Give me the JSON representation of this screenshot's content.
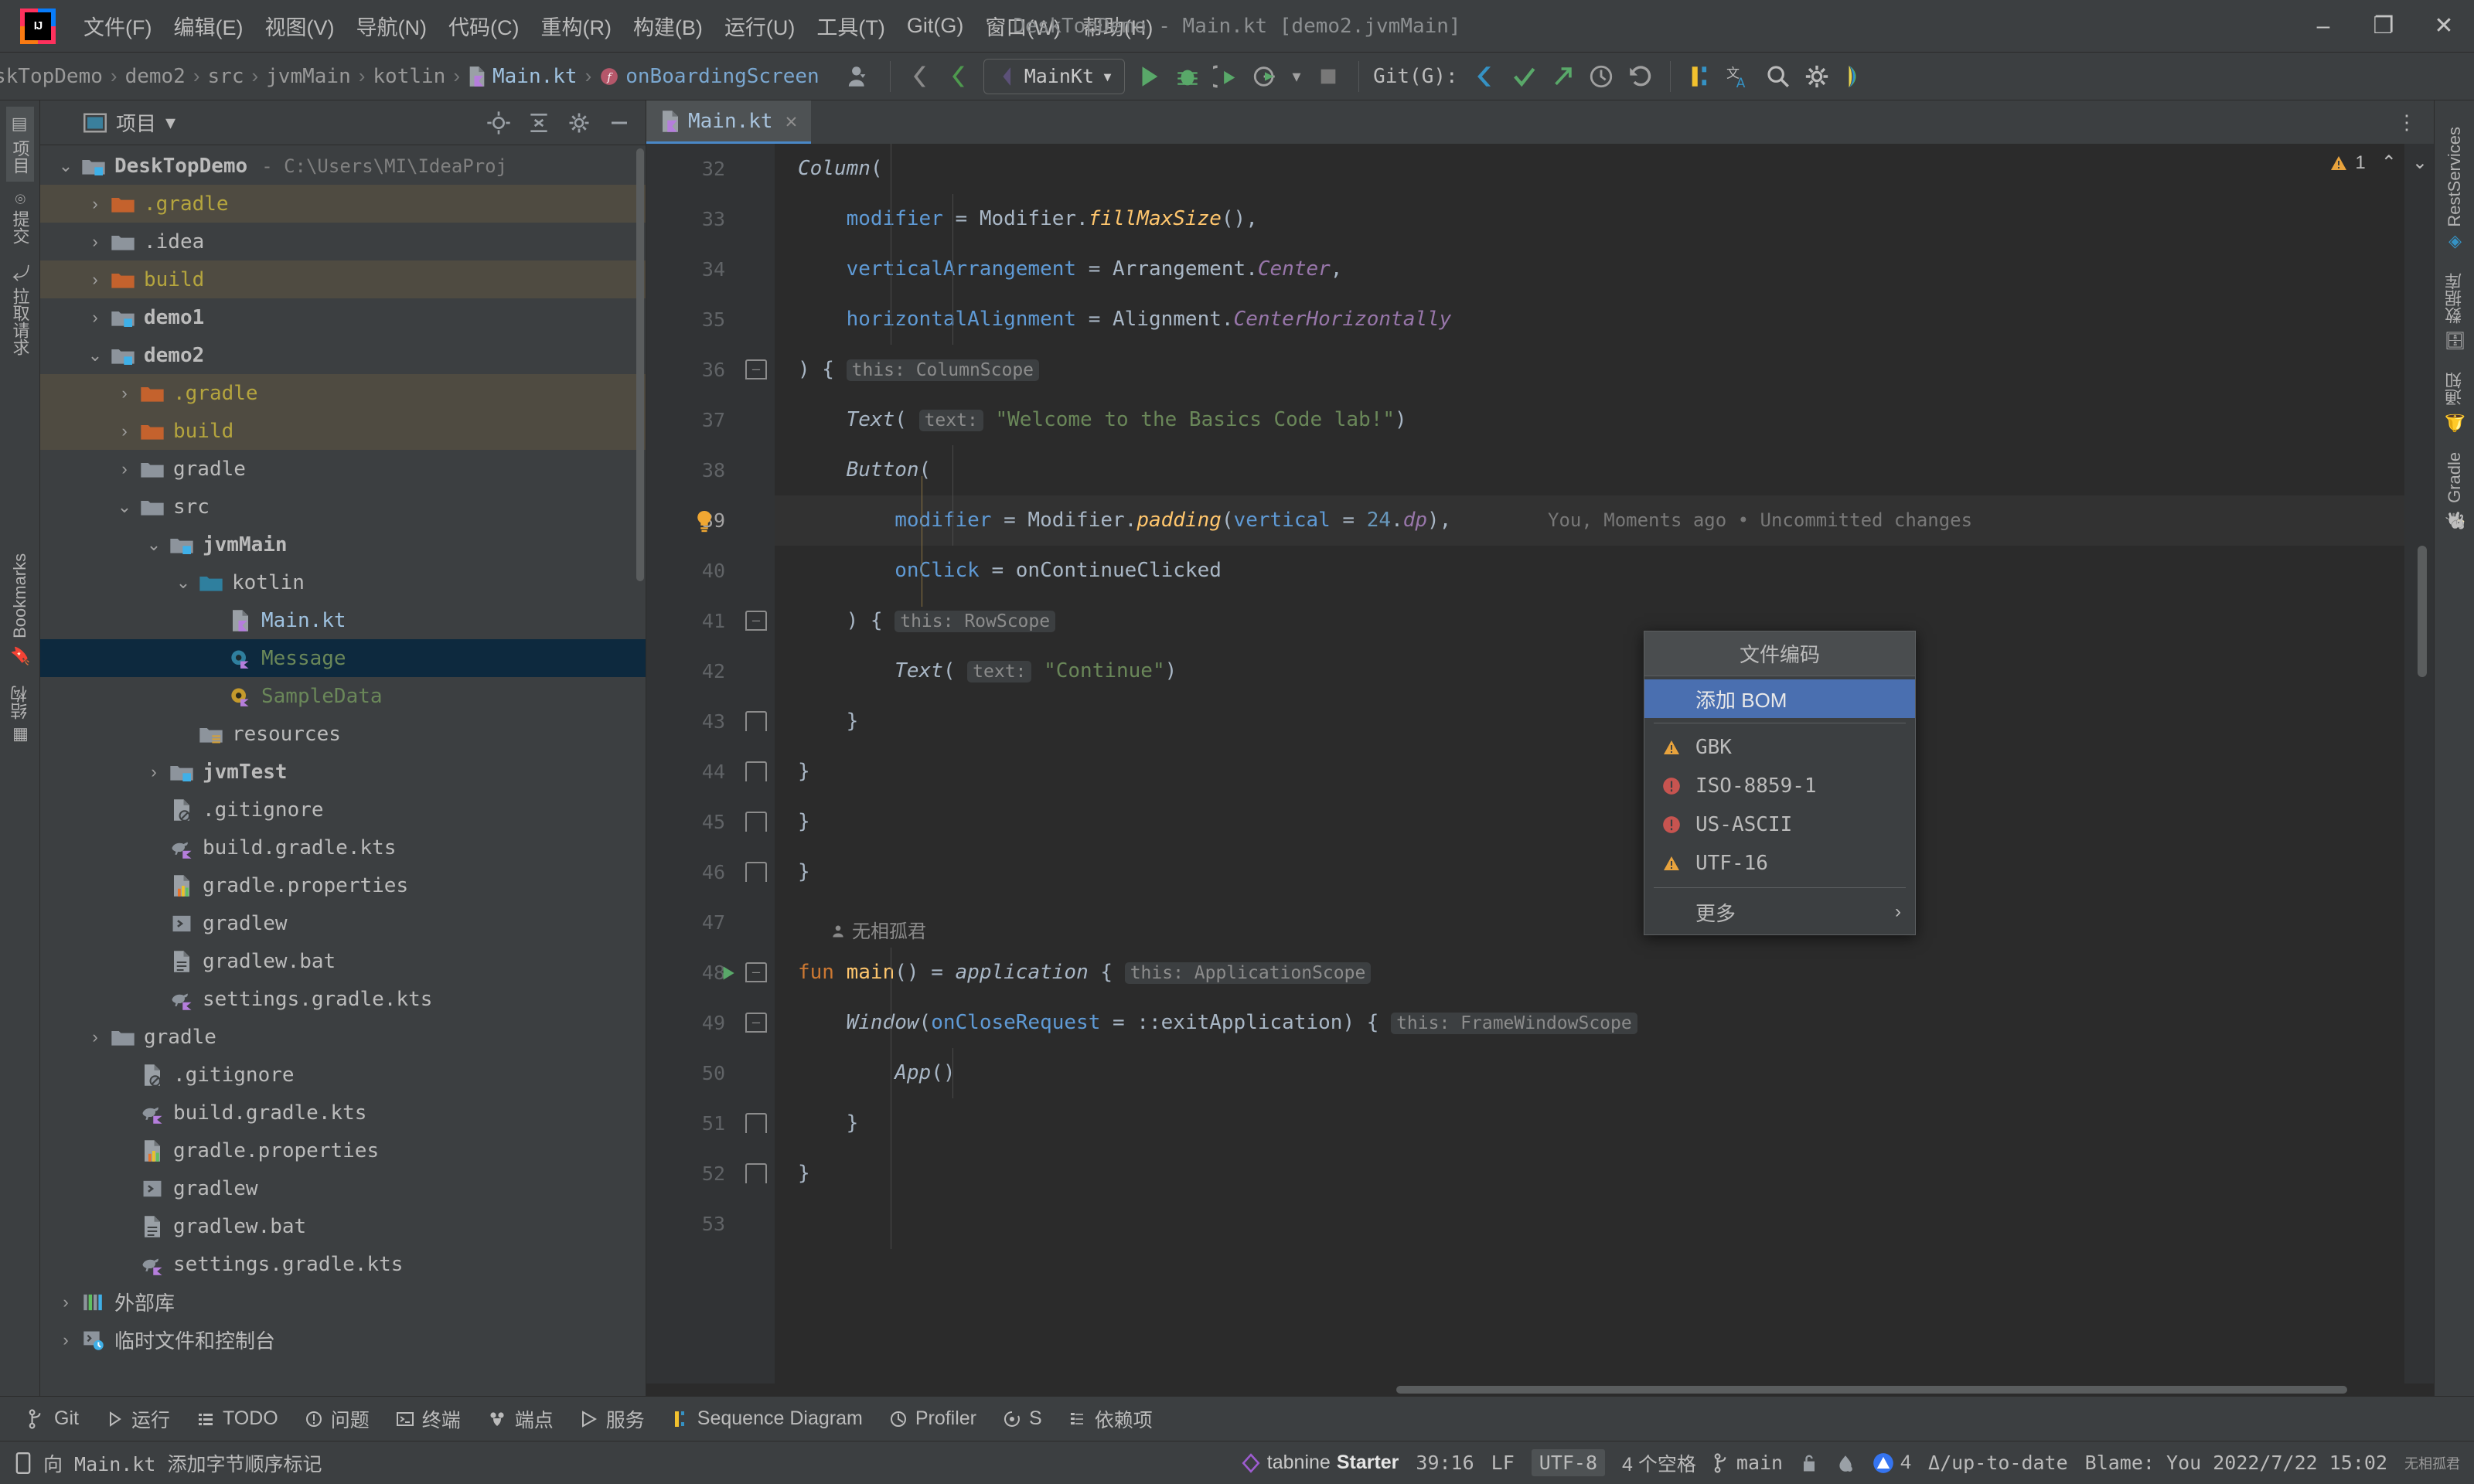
{
  "window": {
    "title": "DeskTopDemo - Main.kt [demo2.jvmMain]",
    "minimize": "–",
    "maximize": "❐",
    "close": "✕",
    "logo_text": "IJ"
  },
  "menubar": {
    "items": [
      {
        "label": "文件(F)",
        "name": "menu-file"
      },
      {
        "label": "编辑(E)",
        "name": "menu-edit"
      },
      {
        "label": "视图(V)",
        "name": "menu-view"
      },
      {
        "label": "导航(N)",
        "name": "menu-navigate"
      },
      {
        "label": "代码(C)",
        "name": "menu-code"
      },
      {
        "label": "重构(R)",
        "name": "menu-refactor"
      },
      {
        "label": "构建(B)",
        "name": "menu-build"
      },
      {
        "label": "运行(U)",
        "name": "menu-run"
      },
      {
        "label": "工具(T)",
        "name": "menu-tools"
      },
      {
        "label": "Git(G)",
        "name": "menu-git"
      },
      {
        "label": "窗口(W)",
        "name": "menu-window"
      },
      {
        "label": "帮助(H)",
        "name": "menu-help"
      }
    ]
  },
  "navbar": {
    "breadcrumbs": [
      {
        "label": "skTopDemo",
        "style": "dim"
      },
      {
        "label": "demo2",
        "style": "dim"
      },
      {
        "label": "src",
        "style": "dim"
      },
      {
        "label": "jvmMain",
        "style": "dim"
      },
      {
        "label": "kotlin",
        "style": "dim"
      },
      {
        "label": "Main.kt",
        "style": "file"
      },
      {
        "label": "onBoardingScreen",
        "style": "fn"
      }
    ],
    "separator": "›",
    "run_config": "MainKt",
    "run_config_caret": "▾",
    "git_label": "Git(G):"
  },
  "sidebar_left": {
    "items": [
      {
        "label": "项目",
        "name": "sidebar-item-project",
        "active": true
      },
      {
        "label": "提交",
        "name": "sidebar-item-commit",
        "active": false
      },
      {
        "label": "拉取请求",
        "name": "sidebar-item-pull-requests",
        "active": false
      },
      {
        "label": "Bookmarks",
        "name": "sidebar-item-bookmarks",
        "active": false
      },
      {
        "label": "结构",
        "name": "sidebar-item-structure",
        "active": false
      }
    ]
  },
  "sidebar_right": {
    "items": [
      {
        "label": "RestServices",
        "name": "sidebar-item-restservices"
      },
      {
        "label": "数据库",
        "name": "sidebar-item-database"
      },
      {
        "label": "通知",
        "name": "sidebar-item-notifications"
      },
      {
        "label": "Gradle",
        "name": "sidebar-item-gradle"
      }
    ]
  },
  "project_panel": {
    "title": "项目",
    "caret": "▾",
    "tree": [
      {
        "label": "DeskTopDemo",
        "path": "- C:\\Users\\MI\\IdeaProj",
        "indent": 0,
        "arrow": "v",
        "icon": "module",
        "style": "bold"
      },
      {
        "label": ".gradle",
        "indent": 1,
        "arrow": ">",
        "icon": "folder-orange",
        "style": "yellow",
        "excluded": true
      },
      {
        "label": ".idea",
        "indent": 1,
        "arrow": ">",
        "icon": "folder",
        "style": ""
      },
      {
        "label": "build",
        "indent": 1,
        "arrow": ">",
        "icon": "folder-orange",
        "style": "yellow",
        "excluded": true
      },
      {
        "label": "demo1",
        "indent": 1,
        "arrow": ">",
        "icon": "module",
        "style": "bold"
      },
      {
        "label": "demo2",
        "indent": 1,
        "arrow": "v",
        "icon": "module",
        "style": "bold"
      },
      {
        "label": ".gradle",
        "indent": 2,
        "arrow": ">",
        "icon": "folder-orange",
        "style": "yellow",
        "excluded": true
      },
      {
        "label": "build",
        "indent": 2,
        "arrow": ">",
        "icon": "folder-orange",
        "style": "yellow",
        "excluded": true
      },
      {
        "label": "gradle",
        "indent": 2,
        "arrow": ">",
        "icon": "folder",
        "style": ""
      },
      {
        "label": "src",
        "indent": 2,
        "arrow": "v",
        "icon": "folder",
        "style": ""
      },
      {
        "label": "jvmMain",
        "indent": 3,
        "arrow": "v",
        "icon": "module",
        "style": "bold"
      },
      {
        "label": "kotlin",
        "indent": 4,
        "arrow": "v",
        "icon": "folder-source",
        "style": ""
      },
      {
        "label": "Main.kt",
        "indent": 5,
        "arrow": "",
        "icon": "kotlin-file",
        "style": "blue"
      },
      {
        "label": "Message",
        "indent": 5,
        "arrow": "",
        "icon": "kotlin-class",
        "style": "green",
        "selected": true
      },
      {
        "label": "SampleData",
        "indent": 5,
        "arrow": "",
        "icon": "kotlin-object",
        "style": "green"
      },
      {
        "label": "resources",
        "indent": 4,
        "arrow": "",
        "icon": "folder-resources",
        "style": ""
      },
      {
        "label": "jvmTest",
        "indent": 3,
        "arrow": ">",
        "icon": "module-test",
        "style": "bold"
      },
      {
        "label": ".gitignore",
        "indent": 3,
        "arrow": "",
        "icon": "gitignore",
        "style": ""
      },
      {
        "label": "build.gradle.kts",
        "indent": 3,
        "arrow": "",
        "icon": "gradle-kts",
        "style": ""
      },
      {
        "label": "gradle.properties",
        "indent": 3,
        "arrow": "",
        "icon": "properties",
        "style": ""
      },
      {
        "label": "gradlew",
        "indent": 3,
        "arrow": "",
        "icon": "shell",
        "style": ""
      },
      {
        "label": "gradlew.bat",
        "indent": 3,
        "arrow": "",
        "icon": "text-file",
        "style": ""
      },
      {
        "label": "settings.gradle.kts",
        "indent": 3,
        "arrow": "",
        "icon": "gradle-kts",
        "style": ""
      },
      {
        "label": "gradle",
        "indent": 1,
        "arrow": ">",
        "icon": "folder",
        "style": ""
      },
      {
        "label": ".gitignore",
        "indent": 2,
        "arrow": "",
        "icon": "gitignore",
        "style": ""
      },
      {
        "label": "build.gradle.kts",
        "indent": 2,
        "arrow": "",
        "icon": "gradle-kts",
        "style": ""
      },
      {
        "label": "gradle.properties",
        "indent": 2,
        "arrow": "",
        "icon": "properties",
        "style": ""
      },
      {
        "label": "gradlew",
        "indent": 2,
        "arrow": "",
        "icon": "shell",
        "style": ""
      },
      {
        "label": "gradlew.bat",
        "indent": 2,
        "arrow": "",
        "icon": "text-file",
        "style": ""
      },
      {
        "label": "settings.gradle.kts",
        "indent": 2,
        "arrow": "",
        "icon": "gradle-kts",
        "style": ""
      },
      {
        "label": "外部库",
        "indent": 0,
        "arrow": ">",
        "icon": "libraries",
        "style": ""
      },
      {
        "label": "临时文件和控制台",
        "indent": 0,
        "arrow": ">",
        "icon": "scratches",
        "style": ""
      }
    ]
  },
  "editor": {
    "tab": {
      "label": "Main.kt",
      "close": "✕"
    },
    "kebab": "⋮",
    "warning_count": "1",
    "warning_up": "⌃",
    "warning_down": "⌄",
    "vcs_annotation": "You, Moments ago • Uncommitted changes",
    "author_inlay": "无相孤君",
    "lines": [
      {
        "num": "32",
        "text": "Column("
      },
      {
        "num": "33",
        "text": "    modifier = Modifier.fillMaxSize(),"
      },
      {
        "num": "34",
        "text": "    verticalArrangement = Arrangement.Center,"
      },
      {
        "num": "35",
        "text": "    horizontalAlignment = Alignment.CenterHorizontally"
      },
      {
        "num": "36",
        "text": ") { this: ColumnScope"
      },
      {
        "num": "37",
        "text": "    Text( text: \"Welcome to the Basics Code lab!\")"
      },
      {
        "num": "38",
        "text": "    Button("
      },
      {
        "num": "39",
        "text": "        modifier = Modifier.padding(vertical = 24.dp),"
      },
      {
        "num": "40",
        "text": "        onClick = onContinueClicked"
      },
      {
        "num": "41",
        "text": "    ) { this: RowScope"
      },
      {
        "num": "42",
        "text": "        Text( text: \"Continue\")"
      },
      {
        "num": "43",
        "text": "    }"
      },
      {
        "num": "44",
        "text": "}"
      },
      {
        "num": "45",
        "text": "}"
      },
      {
        "num": "46",
        "text": "}"
      },
      {
        "num": "47",
        "text": ""
      },
      {
        "num": "48",
        "text": "fun main() = application { this: ApplicationScope"
      },
      {
        "num": "49",
        "text": "    Window(onCloseRequest = ::exitApplication) { this: FrameWindowScope"
      },
      {
        "num": "50",
        "text": "        App()"
      },
      {
        "num": "51",
        "text": "    }"
      },
      {
        "num": "52",
        "text": "}"
      },
      {
        "num": "53",
        "text": ""
      }
    ]
  },
  "popup": {
    "title": "文件编码",
    "items": [
      {
        "label": "添加 BOM",
        "icon": "none",
        "selected": true,
        "cjk": true
      },
      {
        "label": "GBK",
        "icon": "warning",
        "selected": false
      },
      {
        "label": "ISO-8859-1",
        "icon": "error",
        "selected": false
      },
      {
        "label": "US-ASCII",
        "icon": "error",
        "selected": false
      },
      {
        "label": "UTF-16",
        "icon": "warning",
        "selected": false
      },
      {
        "label": "更多",
        "icon": "none",
        "selected": false,
        "chevron": "›",
        "cjk": true
      }
    ]
  },
  "toolwindow_bar": {
    "items": [
      {
        "label": "Git",
        "name": "toolwin-git",
        "icon": "branch-icon"
      },
      {
        "label": "运行",
        "name": "toolwin-run",
        "icon": "play-icon"
      },
      {
        "label": "TODO",
        "name": "toolwin-todo",
        "icon": "list-icon"
      },
      {
        "label": "问题",
        "name": "toolwin-problems",
        "icon": "problem-icon"
      },
      {
        "label": "终端",
        "name": "toolwin-terminal",
        "icon": "terminal-icon"
      },
      {
        "label": "端点",
        "name": "toolwin-endpoints",
        "icon": "endpoints-icon"
      },
      {
        "label": "服务",
        "name": "toolwin-services",
        "icon": "services-icon"
      },
      {
        "label": "Sequence Diagram",
        "name": "toolwin-sequence-diagram",
        "icon": "sequence-icon"
      },
      {
        "label": "Profiler",
        "name": "toolwin-profiler",
        "icon": "profiler-icon"
      },
      {
        "label": "S",
        "name": "toolwin-spring",
        "icon": "spring-icon"
      },
      {
        "label": "依赖项",
        "name": "toolwin-dependencies",
        "icon": "dependencies-icon"
      }
    ]
  },
  "statusbar": {
    "message": "向 Main.kt 添加字节顺序标记",
    "tabnine_brand": "tabnine",
    "tabnine_plan": "Starter",
    "caret": "39:16",
    "line_sep": "LF",
    "encoding": "UTF-8",
    "indent": "4 个空格",
    "branch": "main",
    "lock": "🔒",
    "git_count": "4",
    "git_status": "Δ/up-to-date",
    "blame": "Blame: You 2022/7/22 15:02",
    "blame_suffix": "无相孤君"
  }
}
